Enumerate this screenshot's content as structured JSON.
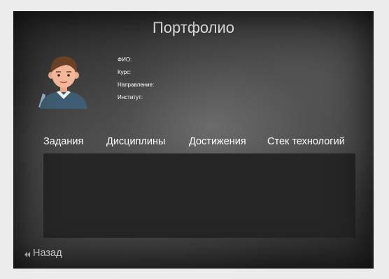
{
  "page": {
    "title": "Портфолио"
  },
  "profile": {
    "avatar_icon": "student-avatar-icon",
    "fields": [
      {
        "label": "ФИО:"
      },
      {
        "label": "Курс:"
      },
      {
        "label": "Направление:"
      },
      {
        "label": "Институт:"
      }
    ]
  },
  "tabs": [
    {
      "label": "Задания"
    },
    {
      "label": "Дисциплины"
    },
    {
      "label": "Достижения"
    },
    {
      "label": "Стек технологий"
    }
  ],
  "back": {
    "label": "Назад",
    "icon": "double-chevron-left-icon"
  },
  "colors": {
    "page_background": "#ececec",
    "panel": "#262626",
    "text": "#ffffff"
  }
}
